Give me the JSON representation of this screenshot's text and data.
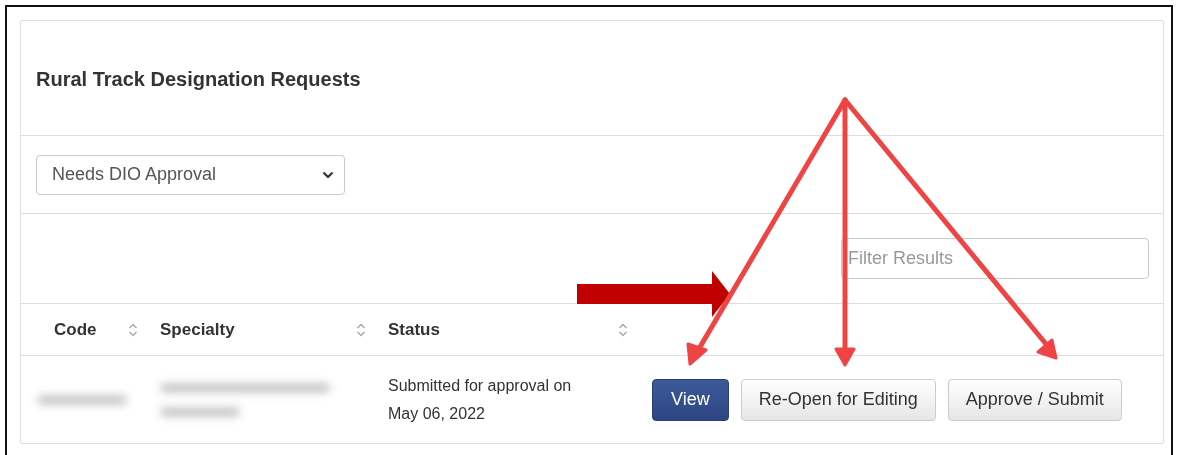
{
  "panel": {
    "title": "Rural Track Designation Requests"
  },
  "status_filter": {
    "value": "Needs DIO Approval"
  },
  "filter": {
    "placeholder": "Filter Results"
  },
  "table": {
    "columns": [
      {
        "label": "Code",
        "sortable": true
      },
      {
        "label": "Specialty",
        "sortable": true
      },
      {
        "label": "Status",
        "sortable": true
      }
    ],
    "rows": [
      {
        "status": "Submitted for approval on May 06, 2022",
        "actions": [
          {
            "label": "View",
            "kind": "primary"
          },
          {
            "label": "Re-Open for Editing",
            "kind": "default"
          },
          {
            "label": "Approve / Submit",
            "kind": "default"
          }
        ]
      }
    ]
  }
}
